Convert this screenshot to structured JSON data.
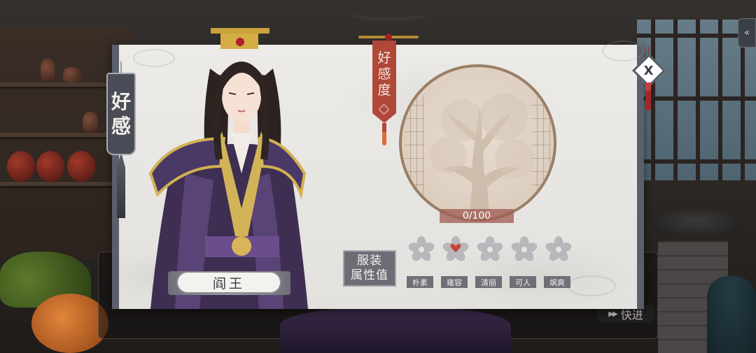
{
  "side_tag": {
    "label_line1": "好",
    "label_line2": "感"
  },
  "character": {
    "name": "阎王"
  },
  "affection": {
    "banner_line1": "好",
    "banner_line2": "感",
    "banner_line3": "度",
    "progress_text": "0/100",
    "current": 0,
    "max": 100
  },
  "attributes": {
    "label_line1": "服装",
    "label_line2": "属性值",
    "items": [
      {
        "label": "朴素",
        "active": false
      },
      {
        "label": "雍容",
        "active": true
      },
      {
        "label": "清丽",
        "active": false
      },
      {
        "label": "可人",
        "active": false
      },
      {
        "label": "飒爽",
        "active": false
      }
    ]
  },
  "close": {
    "symbol": "X"
  },
  "background": {
    "skip_label": "快进",
    "skip_icon": "fast-forward-icon",
    "back_icon": "back-arrow-icon"
  },
  "colors": {
    "accent_red": "#b0483a",
    "panel_frame": "#5b5f6c",
    "flower_gray": "#b8b7bc",
    "flower_active": "#c9423a"
  }
}
